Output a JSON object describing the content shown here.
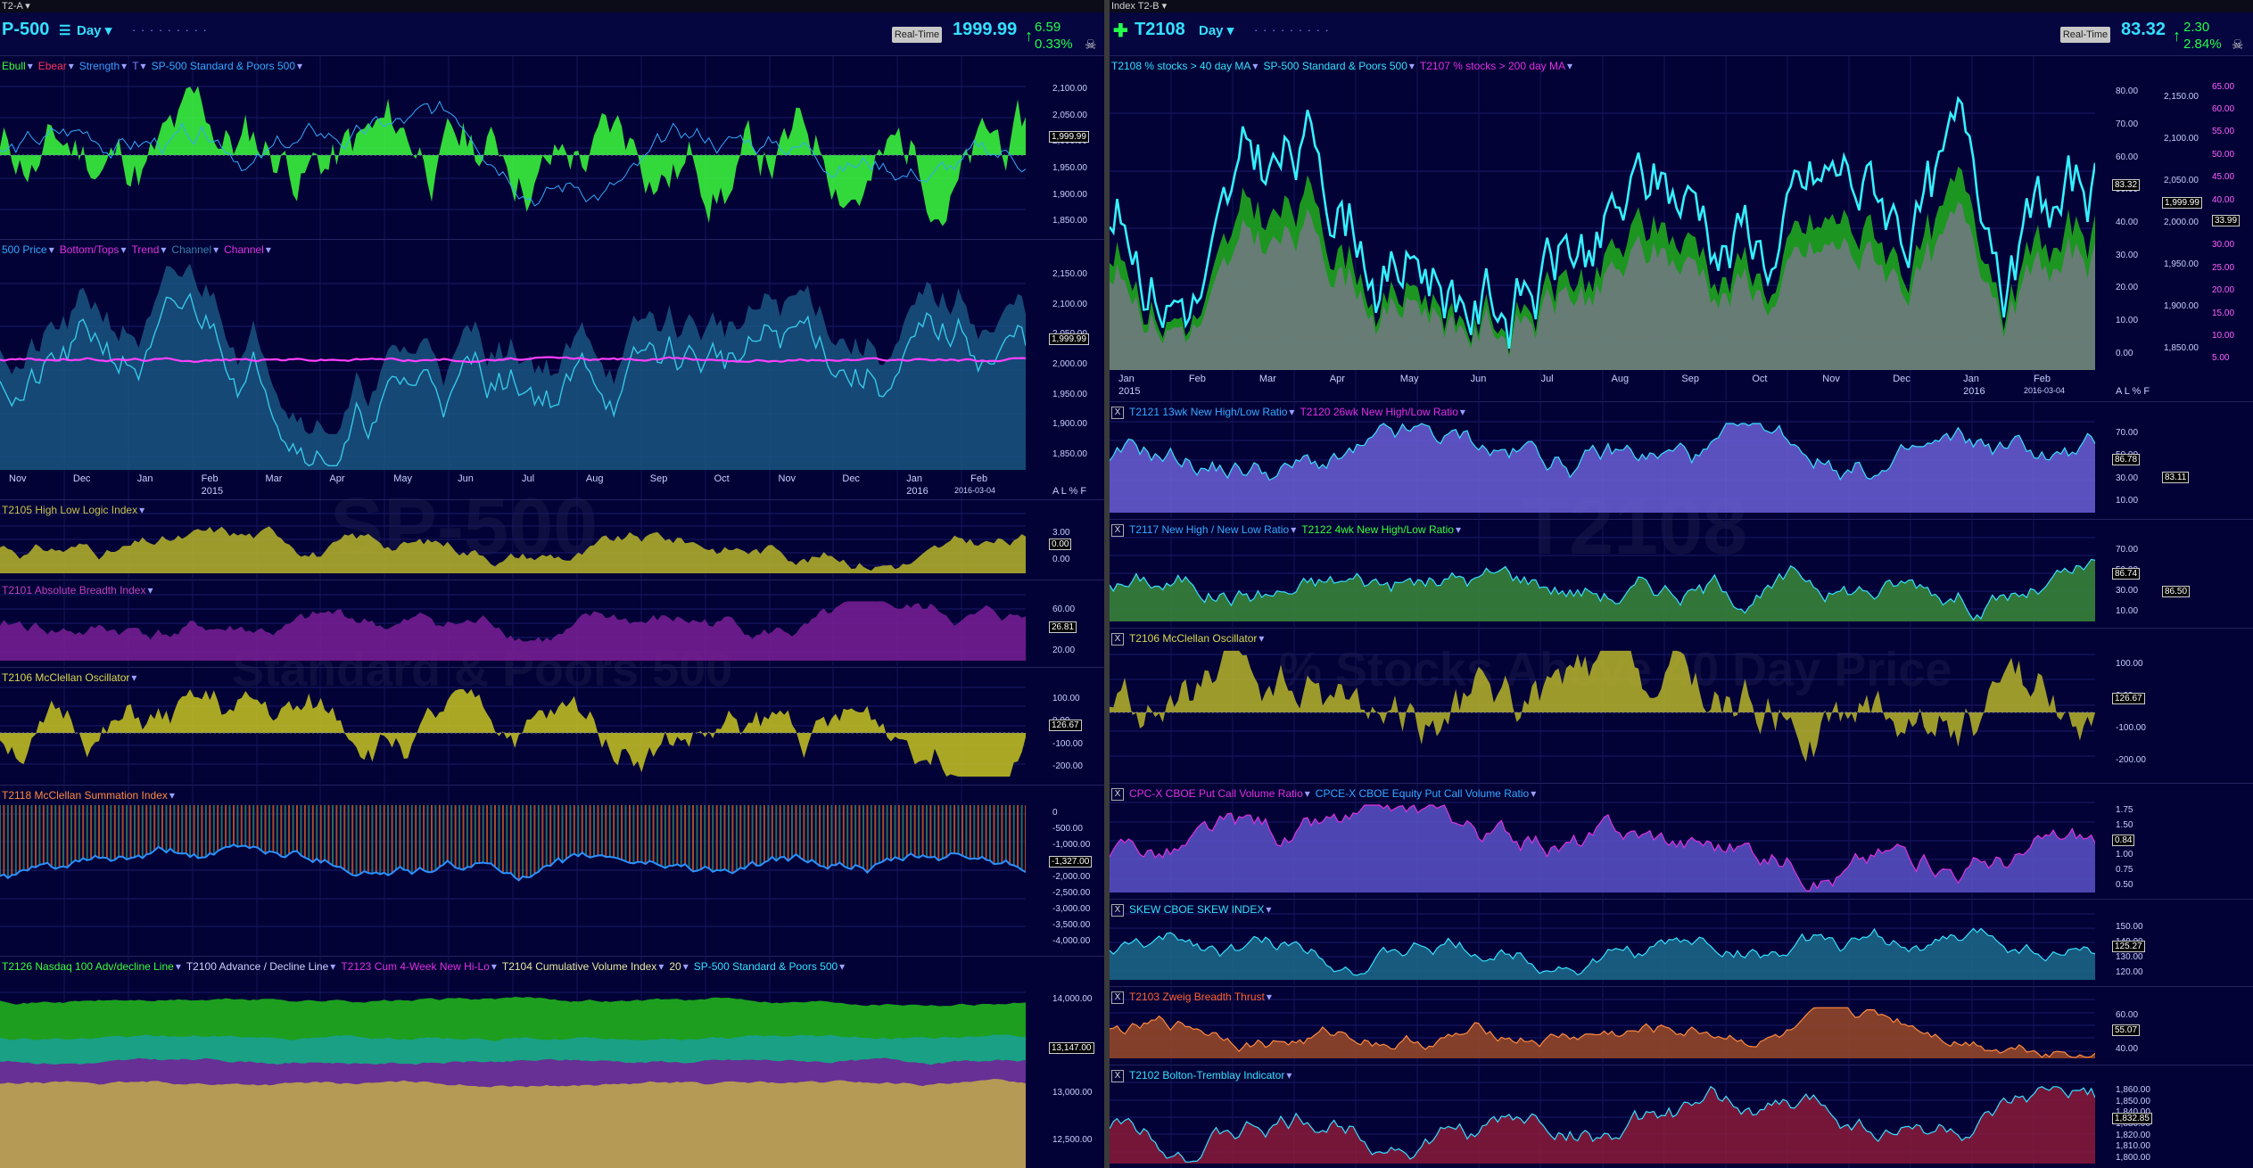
{
  "left": {
    "window_title": "T2-A",
    "symbol": "SP-500",
    "symbol_shown": "P-500",
    "period": "Day",
    "realtime": "Real-Time",
    "price": "1999.99",
    "change": "6.59",
    "change_pct": "0.33%",
    "watermark": "SP-500",
    "watermark2": "Standard & Poors 500",
    "date_stamp": "2016-03-04",
    "axis_controls": "A  L  %  F",
    "panels": [
      {
        "legend": [
          "Ebull",
          "Ebear",
          "Strength",
          "T",
          "SP-500 Standard & Poors 500"
        ],
        "ticks": [
          "2,100.00",
          "2,050.00",
          "2,000.00",
          "1,950.00",
          "1,900.00",
          "1,850.00"
        ],
        "box": "1,999.99"
      },
      {
        "legend": [
          "500 Price",
          "Bottom/Tops",
          "Trend",
          "Channel",
          "Channel"
        ],
        "ticks": [
          "2,150.00",
          "2,100.00",
          "2,050.00",
          "2,000.00",
          "1,950.00",
          "1,900.00",
          "1,850.00"
        ],
        "box": "1,999.99",
        "months": [
          "Nov",
          "Dec",
          "Jan",
          "Feb",
          "Mar",
          "Apr",
          "May",
          "Jun",
          "Jul",
          "Aug",
          "Sep",
          "Oct",
          "Nov",
          "Dec",
          "Jan",
          "Feb"
        ],
        "years": [
          "2015",
          "2016"
        ]
      },
      {
        "legend": [
          "T2105 High Low Logic Index"
        ],
        "ticks": [
          "3.00",
          "0.00"
        ],
        "box": "0.00"
      },
      {
        "legend": [
          "T2101 Absolute Breadth Index"
        ],
        "ticks": [
          "60.00",
          "40.00",
          "20.00"
        ],
        "box": "26.81"
      },
      {
        "legend": [
          "T2106 McClellan Oscillator"
        ],
        "ticks": [
          "100.00",
          "0.00",
          "-100.00",
          "-200.00"
        ],
        "box": "126.67"
      },
      {
        "legend": [
          "T2118 McClellan Summation Index"
        ],
        "ticks": [
          "0",
          "-500.00",
          "-1,000.00",
          "-1,500.00",
          "-2,000.00",
          "-2,500.00",
          "-3,000.00",
          "-3,500.00",
          "-4,000.00"
        ],
        "box": "-1,327.00"
      },
      {
        "legend": [
          "T2126 Nasdaq 100 Adv/decline Line",
          "T2100 Advance / Decline Line",
          "T2123 Cum 4-Week New Hi-Lo",
          "T2104 Cumulative Volume Index",
          "20",
          "SP-500 Standard & Poors 500"
        ],
        "ticks": [
          "14,000.00",
          "13,500.00",
          "13,000.00",
          "12,500.00"
        ],
        "box": "13,147.00"
      }
    ]
  },
  "right": {
    "window_title": "Index T2-B",
    "symbol": "T2108",
    "period": "Day",
    "realtime": "Real-Time",
    "price": "83.32",
    "change": "2.30",
    "change_pct": "2.84%",
    "watermark": "T2108",
    "watermark2": "% Stocks Above 40 Day Price",
    "date_stamp": "2016-03-04",
    "axis_controls": "A  L  %  F",
    "panels": [
      {
        "legend": [
          "T2108 % stocks > 40 day MA",
          "SP-500 Standard & Poors 500",
          "T2107 % stocks > 200 day MA"
        ],
        "ticks": [
          "80.00",
          "70.00",
          "60.00",
          "50.00",
          "40.00",
          "30.00",
          "20.00",
          "10.00",
          "0.00"
        ],
        "ticks2": [
          "2,150.00",
          "2,100.00",
          "2,050.00",
          "2,000.00",
          "1,950.00",
          "1,900.00",
          "1,850.00"
        ],
        "ticks3": [
          "65.00",
          "60.00",
          "55.00",
          "50.00",
          "45.00",
          "40.00",
          "35.00",
          "30.00",
          "25.00",
          "20.00",
          "15.00",
          "10.00",
          "5.00"
        ],
        "box": "83.32",
        "box2": "1,999.99",
        "box3": "33.99",
        "months": [
          "Jan",
          "Feb",
          "Mar",
          "Apr",
          "May",
          "Jun",
          "Jul",
          "Aug",
          "Sep",
          "Oct",
          "Nov",
          "Dec",
          "Jan",
          "Feb"
        ],
        "years": [
          "2015",
          "2016"
        ],
        "first": "14"
      },
      {
        "legend": [
          "T2121 13wk New High/Low Ratio",
          "T2120 26wk New High/Low Ratio"
        ],
        "ticks": [
          "70.00",
          "50.00",
          "30.00",
          "10.00"
        ],
        "box": "86.78",
        "box2": "83.11"
      },
      {
        "legend": [
          "T2117 New High / New Low Ratio",
          "T2122 4wk New High/Low Ratio"
        ],
        "ticks": [
          "70.00",
          "50.00",
          "30.00",
          "10.00"
        ],
        "box": "86.74",
        "box2": "86.50"
      },
      {
        "legend": [
          "T2106 McClellan Oscillator"
        ],
        "ticks": [
          "100.00",
          "0.00",
          "-100.00",
          "-200.00"
        ],
        "box": "126.67"
      },
      {
        "legend": [
          "CPC-X CBOE Put Call Volume Ratio",
          "CPCE-X CBOE Equity Put Call Volume Ratio"
        ],
        "ticks": [
          "1.75",
          "1.50",
          "1.25",
          "1.00",
          "0.75",
          "0.50"
        ],
        "box": "0.84"
      },
      {
        "legend": [
          "SKEW CBOE SKEW INDEX"
        ],
        "ticks": [
          "150.00",
          "140.00",
          "130.00",
          "120.00"
        ],
        "box": "125.27"
      },
      {
        "legend": [
          "T2103 Zweig Breadth Thrust"
        ],
        "ticks": [
          "60.00",
          "50.00",
          "40.00"
        ],
        "box": "55.07"
      },
      {
        "legend": [
          "T2102 Bolton-Tremblay Indicator"
        ],
        "ticks": [
          "1,860.00",
          "1,850.00",
          "1,840.00",
          "1,830.00",
          "1,820.00",
          "1,810.00",
          "1,800.00"
        ],
        "box": "1,832.85"
      }
    ]
  },
  "colors": {
    "bg": "#020236",
    "cyan": "#35e0ff",
    "green": "#1fa61f",
    "magenta": "#e030e0",
    "olive": "#b8b52a",
    "purple": "#7a1f96",
    "orange": "#c0562a",
    "periwinkle": "#6b5fd6"
  }
}
